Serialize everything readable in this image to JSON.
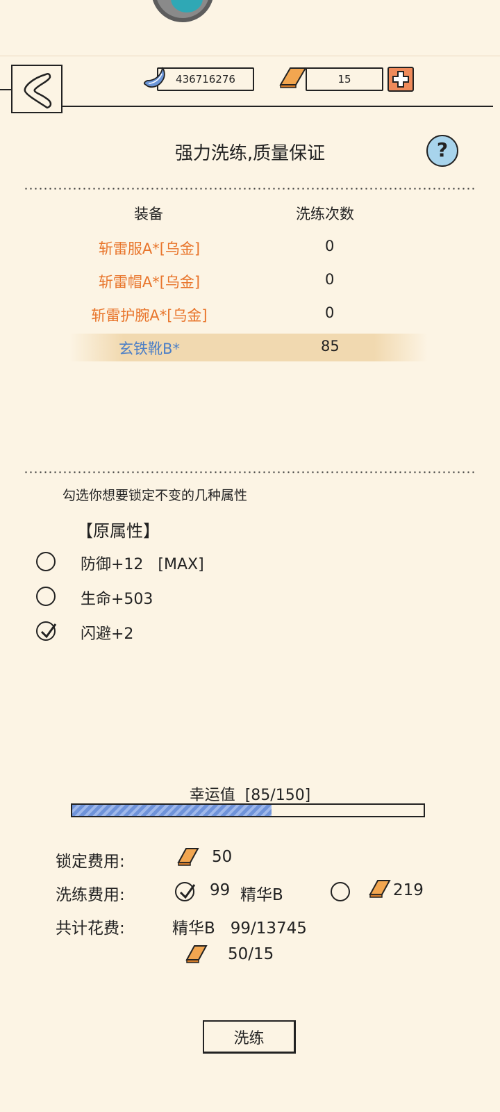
{
  "header": {
    "moon_currency": "436716276",
    "gold_currency": "15"
  },
  "title": "强力洗练,质量保证",
  "table": {
    "col_equipment": "装备",
    "col_count": "洗练次数",
    "rows": [
      {
        "name": "斩雷服A*[乌金]",
        "count": "0"
      },
      {
        "name": "斩雷帽A*[乌金]",
        "count": "0"
      },
      {
        "name": "斩雷护腕A*[乌金]",
        "count": "0"
      },
      {
        "name": "玄铁靴B*",
        "count": "85"
      }
    ]
  },
  "lock_tip": "勾选你想要锁定不变的几种属性",
  "orig_title": "【原属性】",
  "attributes": [
    {
      "label": "防御+12   [MAX]",
      "checked": false
    },
    {
      "label": "生命+503",
      "checked": false
    },
    {
      "label": "闪避+2",
      "checked": true
    }
  ],
  "luck": {
    "label": "幸运值  [85/150]",
    "value": 85,
    "max": 150
  },
  "costs": {
    "lock_label": "锁定费用:",
    "lock_value": "50",
    "wash_label": "洗练费用:",
    "wash_essence_value": "99",
    "wash_essence_name": "精华B",
    "wash_essence_checked": true,
    "wash_gold_value": "219",
    "wash_gold_checked": false,
    "total_label": "共计花费:",
    "total_essence": "精华B   99/13745",
    "total_gold": "50/15"
  },
  "wash_button": "洗练",
  "colors": {
    "background": "#fcf4e4",
    "orange_equipment": "#e8742a",
    "blue_equipment": "#4c7fc6",
    "luck_fill": "#6f93d9",
    "help_button": "#a8d4ec",
    "plus_button": "#ef8a5a"
  }
}
